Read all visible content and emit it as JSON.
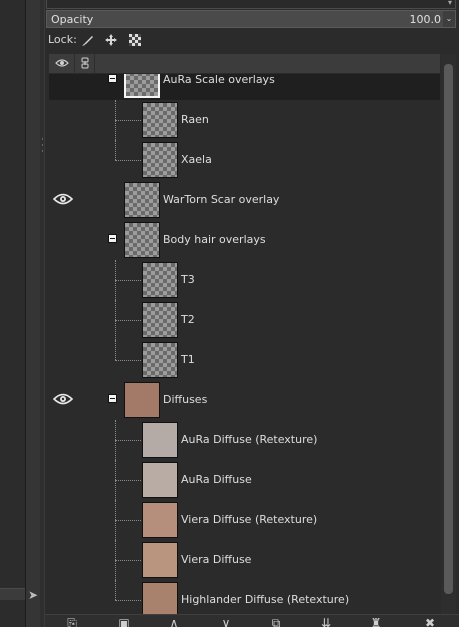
{
  "opacity": {
    "label": "Opacity",
    "value": "100.0"
  },
  "lock": {
    "label": "Lock:"
  },
  "layers": [
    {
      "name": "AuRa Scale overlays",
      "visible": false,
      "group": true,
      "depth": 0,
      "selected": true,
      "thumb": "checker"
    },
    {
      "name": "Raen",
      "visible": false,
      "group": false,
      "depth": 1,
      "thumb": "checker"
    },
    {
      "name": "Xaela",
      "visible": false,
      "group": false,
      "depth": 1,
      "thumb": "checker"
    },
    {
      "name": "WarTorn Scar overlay",
      "visible": true,
      "group": false,
      "depth": 0,
      "thumb": "checker"
    },
    {
      "name": "Body hair overlays",
      "visible": false,
      "group": true,
      "depth": 0,
      "thumb": "checker"
    },
    {
      "name": "T3",
      "visible": false,
      "group": false,
      "depth": 1,
      "thumb": "checker"
    },
    {
      "name": "T2",
      "visible": false,
      "group": false,
      "depth": 1,
      "thumb": "checker"
    },
    {
      "name": "T1",
      "visible": false,
      "group": false,
      "depth": 1,
      "thumb": "checker"
    },
    {
      "name": "Diffuses",
      "visible": true,
      "group": true,
      "depth": 0,
      "thumb": "skin",
      "skin_color": "#a27a67"
    },
    {
      "name": "AuRa Diffuse (Retexture)",
      "visible": false,
      "group": false,
      "depth": 1,
      "thumb": "skin",
      "skin_color": "#b4aaa6"
    },
    {
      "name": "AuRa Diffuse",
      "visible": false,
      "group": false,
      "depth": 1,
      "thumb": "skin",
      "skin_color": "#b9aca4"
    },
    {
      "name": "Viera Diffuse (Retexture)",
      "visible": false,
      "group": false,
      "depth": 1,
      "thumb": "skin",
      "skin_color": "#b58f7b"
    },
    {
      "name": "Viera Diffuse",
      "visible": false,
      "group": false,
      "depth": 1,
      "thumb": "skin",
      "skin_color": "#b99580"
    },
    {
      "name": "Highlander Diffuse (Retexture)",
      "visible": false,
      "group": false,
      "depth": 1,
      "thumb": "skin",
      "skin_color": "#a8826c"
    }
  ],
  "bottom_bar": [
    {
      "icon": "new-layer-icon"
    },
    {
      "icon": "new-layer-group-icon"
    },
    {
      "icon": "raise-layer-icon"
    },
    {
      "icon": "lower-layer-icon"
    },
    {
      "icon": "duplicate-layer-icon"
    },
    {
      "icon": "merge-down-icon"
    },
    {
      "icon": "add-mask-icon"
    },
    {
      "icon": "delete-layer-icon"
    }
  ]
}
